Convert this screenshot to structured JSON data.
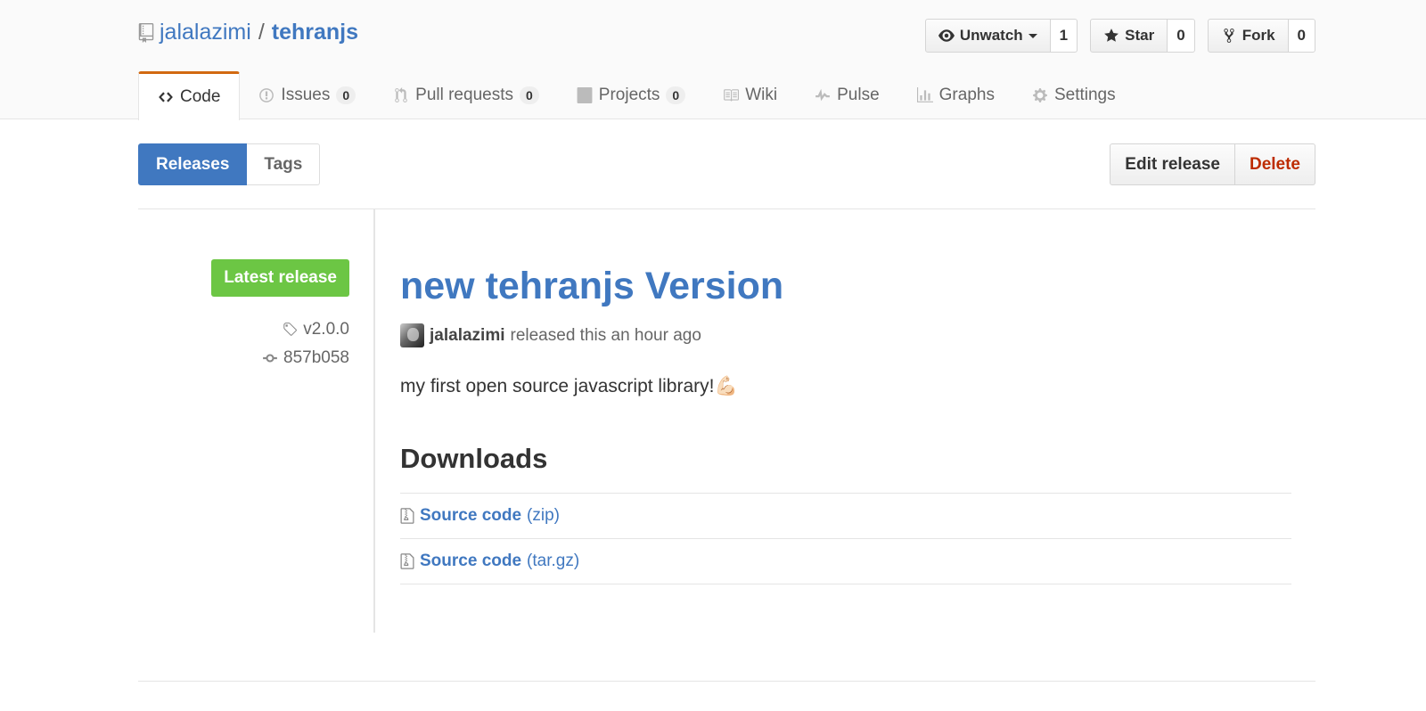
{
  "repo": {
    "owner": "jalalazimi",
    "separator": "/",
    "name": "tehranjs"
  },
  "actions": [
    {
      "label": "Unwatch",
      "count": "1",
      "icon": "eye-icon"
    },
    {
      "label": "Star",
      "count": "0",
      "icon": "star-icon"
    },
    {
      "label": "Fork",
      "count": "0",
      "icon": "fork-icon"
    }
  ],
  "nav": {
    "code": "Code",
    "issues": {
      "label": "Issues",
      "count": "0"
    },
    "pulls": {
      "label": "Pull requests",
      "count": "0"
    },
    "projects": {
      "label": "Projects",
      "count": "0"
    },
    "wiki": "Wiki",
    "pulse": "Pulse",
    "graphs": "Graphs",
    "settings": "Settings"
  },
  "subnav": {
    "releases": "Releases",
    "tags": "Tags"
  },
  "release_actions": {
    "edit": "Edit release",
    "delete": "Delete"
  },
  "release": {
    "badge": "Latest release",
    "tag": "v2.0.0",
    "commit": "857b058",
    "title": "new tehranjs Version",
    "author": "jalalazimi",
    "released_text": "released this an hour ago",
    "description": "my first open source javascript library!💪🏻",
    "downloads_heading": "Downloads",
    "downloads": [
      {
        "name": "Source code",
        "format": "(zip)"
      },
      {
        "name": "Source code",
        "format": "(tar.gz)"
      }
    ]
  },
  "colors": {
    "link": "#4078c0",
    "badge": "#6cc644",
    "danger": "#bd2c00",
    "nav_accent": "#d26911"
  }
}
